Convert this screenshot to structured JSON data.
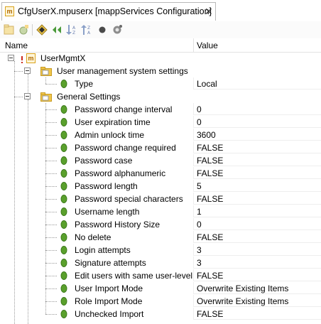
{
  "tab": {
    "title": "CfgUserX.mpuserx [mappServices Configuration]",
    "close": "✕",
    "file_icon_glyph": "m"
  },
  "toolbar": {
    "icons": [
      "new-folder-icon",
      "add-item-icon",
      "move-up-icon",
      "move-down-icon",
      "sort-az-icon",
      "sort-za-icon",
      "record-icon",
      "settings-icon"
    ]
  },
  "columns": {
    "name": "Name",
    "value": "Value"
  },
  "tree": {
    "root": {
      "label": "UserMgmtX",
      "icon_glyph": "m"
    },
    "group1": {
      "label": "User management system settings",
      "items": [
        {
          "label": "Type",
          "value": "Local"
        }
      ]
    },
    "group2": {
      "label": "General Settings",
      "items": [
        {
          "label": "Password change interval",
          "value": "0"
        },
        {
          "label": "User expiration time",
          "value": "0"
        },
        {
          "label": "Admin unlock time",
          "value": "3600"
        },
        {
          "label": "Password change required",
          "value": "FALSE"
        },
        {
          "label": "Password case",
          "value": "FALSE"
        },
        {
          "label": "Password alphanumeric",
          "value": "FALSE"
        },
        {
          "label": "Password length",
          "value": "5"
        },
        {
          "label": "Password special characters",
          "value": "FALSE"
        },
        {
          "label": "Username length",
          "value": "1"
        },
        {
          "label": "Password History Size",
          "value": "0"
        },
        {
          "label": "No delete",
          "value": "FALSE"
        },
        {
          "label": "Login attempts",
          "value": "3"
        },
        {
          "label": "Signature attempts",
          "value": "3"
        },
        {
          "label": "Edit users with same user-level",
          "value": "FALSE"
        },
        {
          "label": "User Import Mode",
          "value": "Overwrite Existing Items"
        },
        {
          "label": "Role Import Mode",
          "value": "Overwrite Existing Items"
        },
        {
          "label": "Unchecked Import",
          "value": "FALSE"
        }
      ]
    }
  },
  "colors": {
    "leaf_green": "#5aa02c",
    "folder_yellow": "#f1c64a",
    "root_red": "#cc2a1e",
    "file_orange": "#d9a21b"
  }
}
